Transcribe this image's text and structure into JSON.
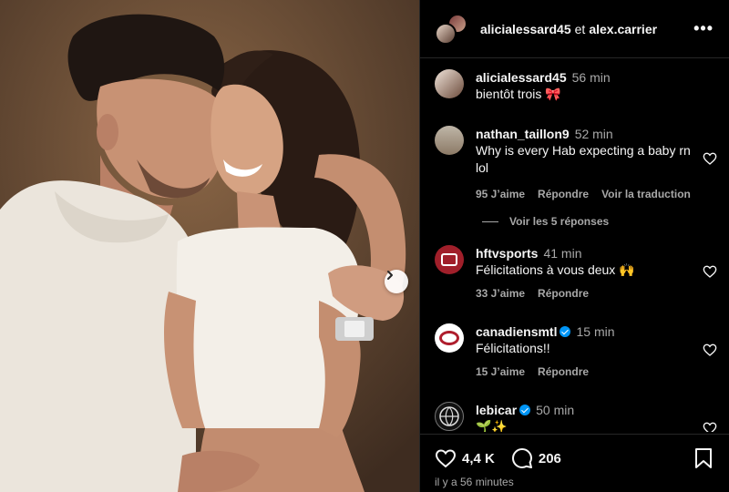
{
  "header": {
    "user1": "alicialessard45",
    "conjunction": "et",
    "user2": "alex.carrier",
    "more_icon": "more-horizontal-icon"
  },
  "caption": {
    "username": "alicialessard45",
    "time": "56 min",
    "text": "bientôt trois 🎀"
  },
  "comments": [
    {
      "username": "nathan_taillon9",
      "time": "52 min",
      "text": "Why is every Hab expecting a baby rn lol",
      "likes": "95 J’aime",
      "reply": "Répondre",
      "translate": "Voir la traduction",
      "verified": false
    },
    {
      "username": "hftvsports",
      "time": "41 min",
      "text": "Félicitations à vous deux 🙌",
      "likes": "33 J’aime",
      "reply": "Répondre",
      "verified": false
    },
    {
      "username": "canadiensmtl",
      "time": "15 min",
      "text": "Félicitations!!",
      "likes": "15 J’aime",
      "reply": "Répondre",
      "verified": true
    },
    {
      "username": "lebicar",
      "time": "50 min",
      "text": "🌱✨",
      "verified": true
    }
  ],
  "view_replies": "Voir les 5 réponses",
  "footer": {
    "likes_count": "4,4 K",
    "comments_count": "206",
    "posted": "il y a 56 minutes"
  },
  "colors": {
    "background": "#000000",
    "text": "#f5f5f5",
    "secondary_text": "#a8a8a8",
    "verified": "#0095f6",
    "divider": "#262626"
  }
}
